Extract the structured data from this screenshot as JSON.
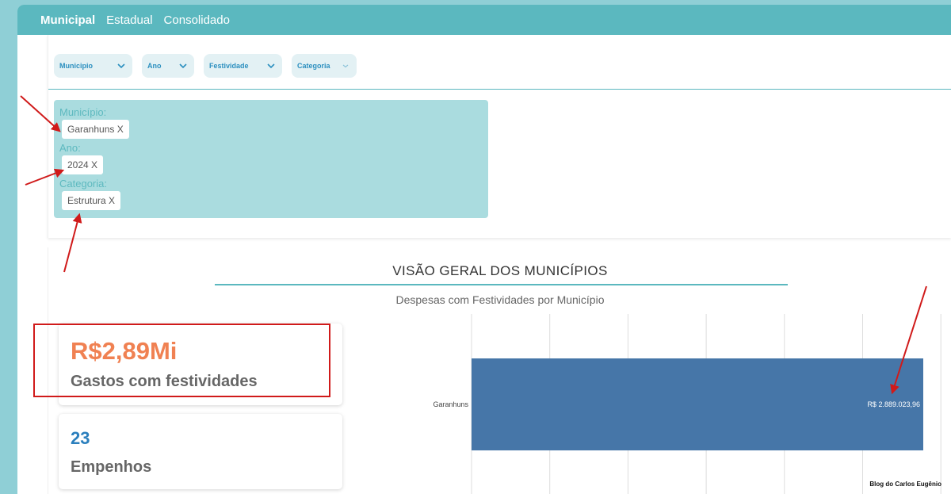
{
  "nav": {
    "tabs": [
      {
        "label": "Municipal",
        "active": true
      },
      {
        "label": "Estadual",
        "active": false
      },
      {
        "label": "Consolidado",
        "active": false
      }
    ]
  },
  "filters": [
    {
      "label": "Municipio"
    },
    {
      "label": "Ano"
    },
    {
      "label": "Festividade"
    },
    {
      "label": "Categoria"
    }
  ],
  "selected": [
    {
      "label": "Município:",
      "chip": "Garanhuns X"
    },
    {
      "label": "Ano:",
      "chip": "2024 X"
    },
    {
      "label": "Categoria:",
      "chip": "Estrutura X"
    }
  ],
  "overview": {
    "title": "VISÃO GERAL DOS MUNICÍPIOS"
  },
  "kpis": [
    {
      "value": "R$2,89Mi",
      "label": "Gastos com festividades"
    },
    {
      "value": "23",
      "label": "Empenhos"
    }
  ],
  "chart_data": {
    "type": "bar",
    "orientation": "horizontal",
    "title": "Despesas com Festividades por Município",
    "categories": [
      "Garanhuns"
    ],
    "values": [
      2889023.96
    ],
    "data_labels": [
      "R$ 2.889.023,96"
    ],
    "grid": true,
    "bar_color": "#4676a8"
  },
  "watermark": "Blog do Carlos Eugênio",
  "colors": {
    "accent": "#5bb8bf",
    "kpi_orange": "#f08152",
    "kpi_blue": "#2b7fbd",
    "annotation_red": "#d01a1a"
  }
}
